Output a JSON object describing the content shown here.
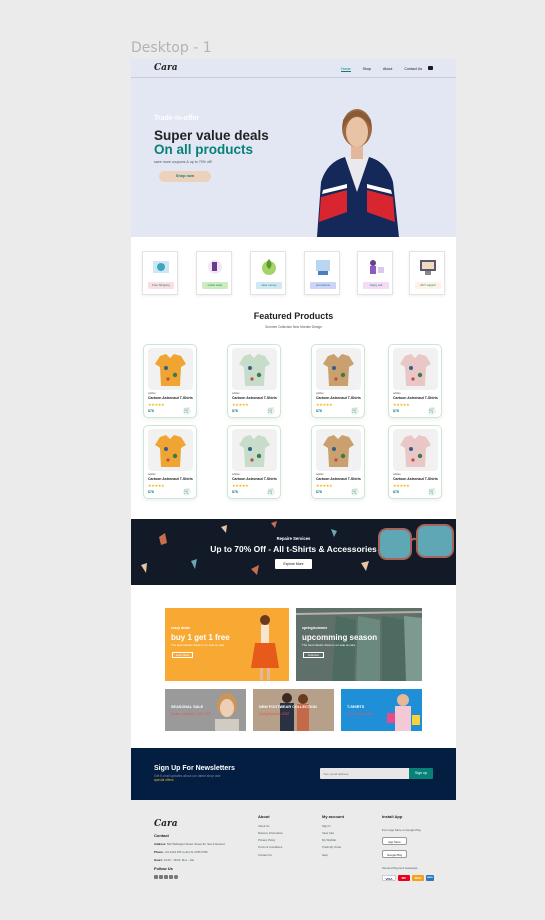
{
  "frame_label": "Desktop - 1",
  "header": {
    "logo": "Cara",
    "nav": [
      "Home",
      "Shop",
      "About",
      "Contact Us"
    ],
    "active_nav": "Home",
    "bag_icon": "shopping-bag-icon"
  },
  "hero": {
    "kicker": "Trade-in-offer",
    "title_line1": "Super value deals",
    "title_line2": "On all products",
    "text": "save more coupons & up to 70% off!",
    "button": "Shop now"
  },
  "features": [
    {
      "label": "Free Shipping",
      "bg": "#fddde4"
    },
    {
      "label": "online order",
      "bg": "#cdebbc"
    },
    {
      "label": "save money",
      "bg": "#d1e8f2"
    },
    {
      "label": "promotions",
      "bg": "#cdd4f8"
    },
    {
      "label": "happy sell",
      "bg": "#f6dbf6"
    },
    {
      "label": "24/7 support",
      "bg": "#fff2e5"
    }
  ],
  "featured": {
    "title": "Featured Products",
    "subtitle": "Summer Collection New Morden Design",
    "products": [
      {
        "brand": "adidas",
        "name": "Cartoon Astronaut T-Shirts",
        "stars": "★★★★★",
        "price": "$78"
      },
      {
        "brand": "adidas",
        "name": "Cartoon Astronaut T-Shirts",
        "stars": "★★★★★",
        "price": "$78"
      },
      {
        "brand": "adidas",
        "name": "Cartoon Astronaut T-Shirts",
        "stars": "★★★★★",
        "price": "$78"
      },
      {
        "brand": "adidas",
        "name": "Cartoon Astronaut T-Shirts",
        "stars": "★★★★★",
        "price": "$78"
      },
      {
        "brand": "adidas",
        "name": "Cartoon Astronaut T-Shirts",
        "stars": "★★★★★",
        "price": "$78"
      },
      {
        "brand": "adidas",
        "name": "Cartoon Astronaut T-Shirts",
        "stars": "★★★★★",
        "price": "$78"
      },
      {
        "brand": "adidas",
        "name": "Cartoon Astronaut T-Shirts",
        "stars": "★★★★★",
        "price": "$78"
      },
      {
        "brand": "adidas",
        "name": "Cartoon Astronaut T-Shirts",
        "stars": "★★★★★",
        "price": "$78"
      }
    ],
    "shirt_colors": [
      "#f0a431",
      "#c7dcc9",
      "#c9a06e",
      "#e9c7c7"
    ]
  },
  "banner": {
    "kicker": "Repaire Services",
    "title": "Up to 70% Off - All t-Shirts & Accessories",
    "button": "Explore More"
  },
  "promos": {
    "big1": {
      "kicker": "crazy deals",
      "title": "buy 1 get 1 free",
      "text": "The best classic dress is on sale at cara",
      "button": "Learn More"
    },
    "big2": {
      "kicker": "spring/summer",
      "title": "upcomming season",
      "text": "The best classic dress is on sale at cara",
      "button": "Collection"
    },
    "small1": {
      "title": "SEASONAL SALE",
      "text": "Winter Collection -50% OFF"
    },
    "small2": {
      "title": "NEW FOOTWEAR COLLECTION",
      "text": "Spring/Summer 2022"
    },
    "small3": {
      "title": "T-SHIRTS",
      "text": "New Trendy Prints"
    }
  },
  "newsletter": {
    "title": "Sign Up For Newsletters",
    "text": "Get E-mail updates about our latest shop and",
    "text_highlight": "special offers.",
    "placeholder": "Your email address",
    "button": "Sign up"
  },
  "footer": {
    "logo": "Cara",
    "contact_title": "Contact",
    "address_label": "Address:",
    "address": "562 Wellington Road, Street 32, San Francisco",
    "phone_label": "Phone:",
    "phone": "+01 2222 365 /(+91) 01 2345 6789",
    "hours_label": "Hours:",
    "hours": "10:00 - 18:00, Mon - Sat",
    "follow_title": "Follow Us",
    "about_title": "About",
    "about_links": [
      "About Us",
      "Delivery Information",
      "Privacy Policy",
      "Terms & Conditions",
      "Contact Us"
    ],
    "account_title": "My account",
    "account_links": [
      "Sign In",
      "View Cart",
      "My Wishlist",
      "Track My Order",
      "Help"
    ],
    "install_title": "Install App",
    "install_text": "From App Store or Google Play",
    "app_store": "App Store",
    "google_play": "Google Play",
    "secured_text": "Secured Payment Gateways",
    "payments": [
      "VISA",
      "MC",
      "MAE",
      "AMEX"
    ]
  }
}
